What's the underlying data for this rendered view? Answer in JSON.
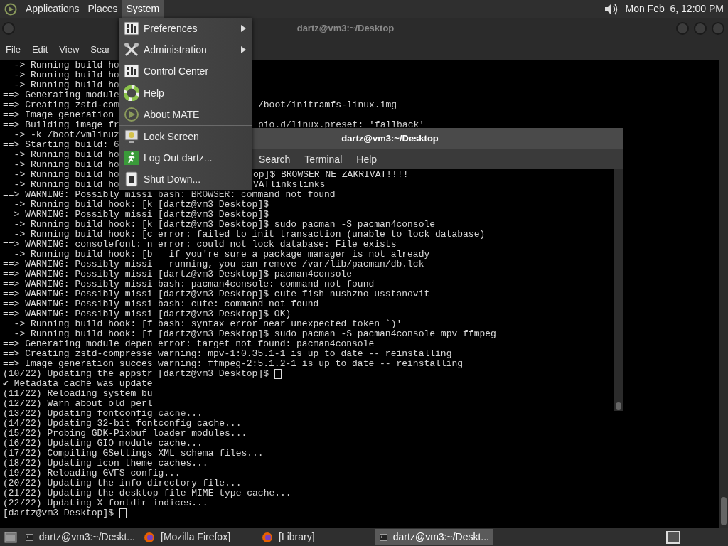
{
  "top_panel": {
    "menus": [
      {
        "label": "Applications",
        "selected": false
      },
      {
        "label": "Places",
        "selected": false
      },
      {
        "label": "System",
        "selected": true
      }
    ],
    "clock": "Mon Feb  6, 12:00 PM"
  },
  "back_window": {
    "title": "dartz@vm3:~/Desktop",
    "menus": [
      "File",
      "Edit",
      "View",
      "Sear"
    ],
    "lines": [
      {
        "text": "  -> Running build ho"
      },
      {
        "text": "  -> Running build ho"
      },
      {
        "text": "  -> Running build ho"
      },
      {
        "text": "==> Generating module"
      },
      {
        "text": "==> Creating zstd-com",
        "tail": "/boot/initramfs-linux.img"
      },
      {
        "text": "==> Image generation"
      },
      {
        "text": "==> Building image fr",
        "tail": "pio.d/linux.preset: 'fallback'"
      },
      {
        "text": "  -> -k /boot/vmlinuz"
      },
      {
        "text": "==> Starting build: 6"
      },
      {
        "text": "  -> Running build ho"
      },
      {
        "text": "  -> Running build ho"
      },
      {
        "text": "  -> Running build ho"
      },
      {
        "text": "  -> Running build ho"
      },
      {
        "text": "==> WARNING: Possibly missi"
      },
      {
        "text": "  -> Running build hook: [k"
      },
      {
        "text": "==> WARNING: Possibly missi"
      },
      {
        "text": "  -> Running build hook: [k"
      },
      {
        "text": "  -> Running build hook: [c"
      },
      {
        "text": "==> WARNING: consolefont: n"
      },
      {
        "text": "  -> Running build hook: [b"
      },
      {
        "text": "==> WARNING: Possibly missi"
      },
      {
        "text": "==> WARNING: Possibly missi"
      },
      {
        "text": "==> WARNING: Possibly missi"
      },
      {
        "text": "==> WARNING: Possibly missi"
      },
      {
        "text": "==> WARNING: Possibly missi"
      },
      {
        "text": "==> WARNING: Possibly missi"
      },
      {
        "text": "  -> Running build hook: [f"
      },
      {
        "text": "  -> Running build hook: [f"
      },
      {
        "text": "==> Generating module depen"
      },
      {
        "text": "==> Creating zstd-compresse"
      },
      {
        "text": "==> Image generation succes"
      },
      {
        "text": "(10/22) Updating the appstr"
      },
      {
        "text": "✔ Metadata cache was update"
      },
      {
        "text": "(11/22) Reloading system bu"
      },
      {
        "text": "(12/22) Warn about old perl"
      },
      {
        "text": "(13/22) Updating fontconfig cache..."
      },
      {
        "text": "(14/22) Updating 32-bit fontconfig cache..."
      },
      {
        "text": "(15/22) Probing GDK-Pixbuf loader modules..."
      },
      {
        "text": "(16/22) Updating GIO module cache..."
      },
      {
        "text": "(17/22) Compiling GSettings XML schema files..."
      },
      {
        "text": "(18/22) Updating icon theme caches..."
      },
      {
        "text": "(19/22) Reloading GVFS config..."
      },
      {
        "text": "(20/22) Updating the info directory file..."
      },
      {
        "text": "(21/22) Updating the desktop file MIME type cache..."
      },
      {
        "text": "(22/22) Updating X fontdir indices..."
      },
      {
        "text": "[dartz@vm3 Desktop]$ ",
        "cursor": true
      }
    ]
  },
  "system_menu": {
    "groups": [
      [
        {
          "label": "Preferences",
          "submenu": true
        },
        {
          "label": "Administration",
          "submenu": true
        },
        {
          "label": "Control Center",
          "submenu": false
        }
      ],
      [
        {
          "label": "Help",
          "submenu": false
        },
        {
          "label": "About MATE",
          "submenu": false
        }
      ],
      [
        {
          "label": "Lock Screen",
          "submenu": false
        },
        {
          "label": "Log Out dartz...",
          "submenu": false
        },
        {
          "label": "Shut Down...",
          "submenu": false
        }
      ]
    ]
  },
  "front_window": {
    "title": "dartz@vm3:~/Desktop",
    "menus": [
      "Search",
      "Terminal",
      "Help"
    ],
    "lines": [
      {
        "text": "op]$ BROWSER NE ZAKRIVAT!!!!",
        "kind": "clipped"
      },
      {
        "text": "VATlinkslinks",
        "kind": "clipped"
      },
      {
        "text": "bash: BROWSER: command not found",
        "kind": "full"
      },
      {
        "text": "[dartz@vm3 Desktop]$",
        "kind": "full"
      },
      {
        "text": "[dartz@vm3 Desktop]$",
        "kind": "full"
      },
      {
        "text": "[dartz@vm3 Desktop]$ sudo pacman -S pacman4console",
        "kind": "full"
      },
      {
        "text": "error: failed to init transaction (unable to lock database)",
        "kind": "full"
      },
      {
        "text": "error: could not lock database: File exists",
        "kind": "full"
      },
      {
        "text": "  if you're sure a package manager is not already",
        "kind": "full"
      },
      {
        "text": "  running, you can remove /var/lib/pacman/db.lck",
        "kind": "full"
      },
      {
        "text": "[dartz@vm3 Desktop]$ pacman4console",
        "kind": "full"
      },
      {
        "text": "bash: pacman4console: command not found",
        "kind": "full"
      },
      {
        "text": "[dartz@vm3 Desktop]$ cute fish nushzno usstanovit",
        "kind": "full"
      },
      {
        "text": "bash: cute: command not found",
        "kind": "full"
      },
      {
        "text": "[dartz@vm3 Desktop]$ OK)",
        "kind": "full"
      },
      {
        "text": "bash: syntax error near unexpected token `)'",
        "kind": "full"
      },
      {
        "text": "[dartz@vm3 Desktop]$ sudo pacman -S pacman4console mpv ffmpeg",
        "kind": "full"
      },
      {
        "text": "error: target not found: pacman4console",
        "kind": "full"
      },
      {
        "text": "warning: mpv-1:0.35.1-1 is up to date -- reinstalling",
        "kind": "full"
      },
      {
        "text": "warning: ffmpeg-2:5.1.2-1 is up to date -- reinstalling",
        "kind": "full"
      },
      {
        "text": "[dartz@vm3 Desktop]$ ",
        "kind": "full",
        "cursor": true
      }
    ]
  },
  "taskbar": {
    "tasks": [
      {
        "label": "dartz@vm3:~/Deskt...",
        "kind": "terminal",
        "selected": false
      },
      {
        "label": "[Mozilla Firefox]",
        "kind": "browser",
        "selected": false
      },
      {
        "label": "[Library]",
        "kind": "browser",
        "selected": false
      },
      {
        "label": "dartz@vm3:~/Deskt...",
        "kind": "terminal",
        "selected": true
      }
    ]
  }
}
